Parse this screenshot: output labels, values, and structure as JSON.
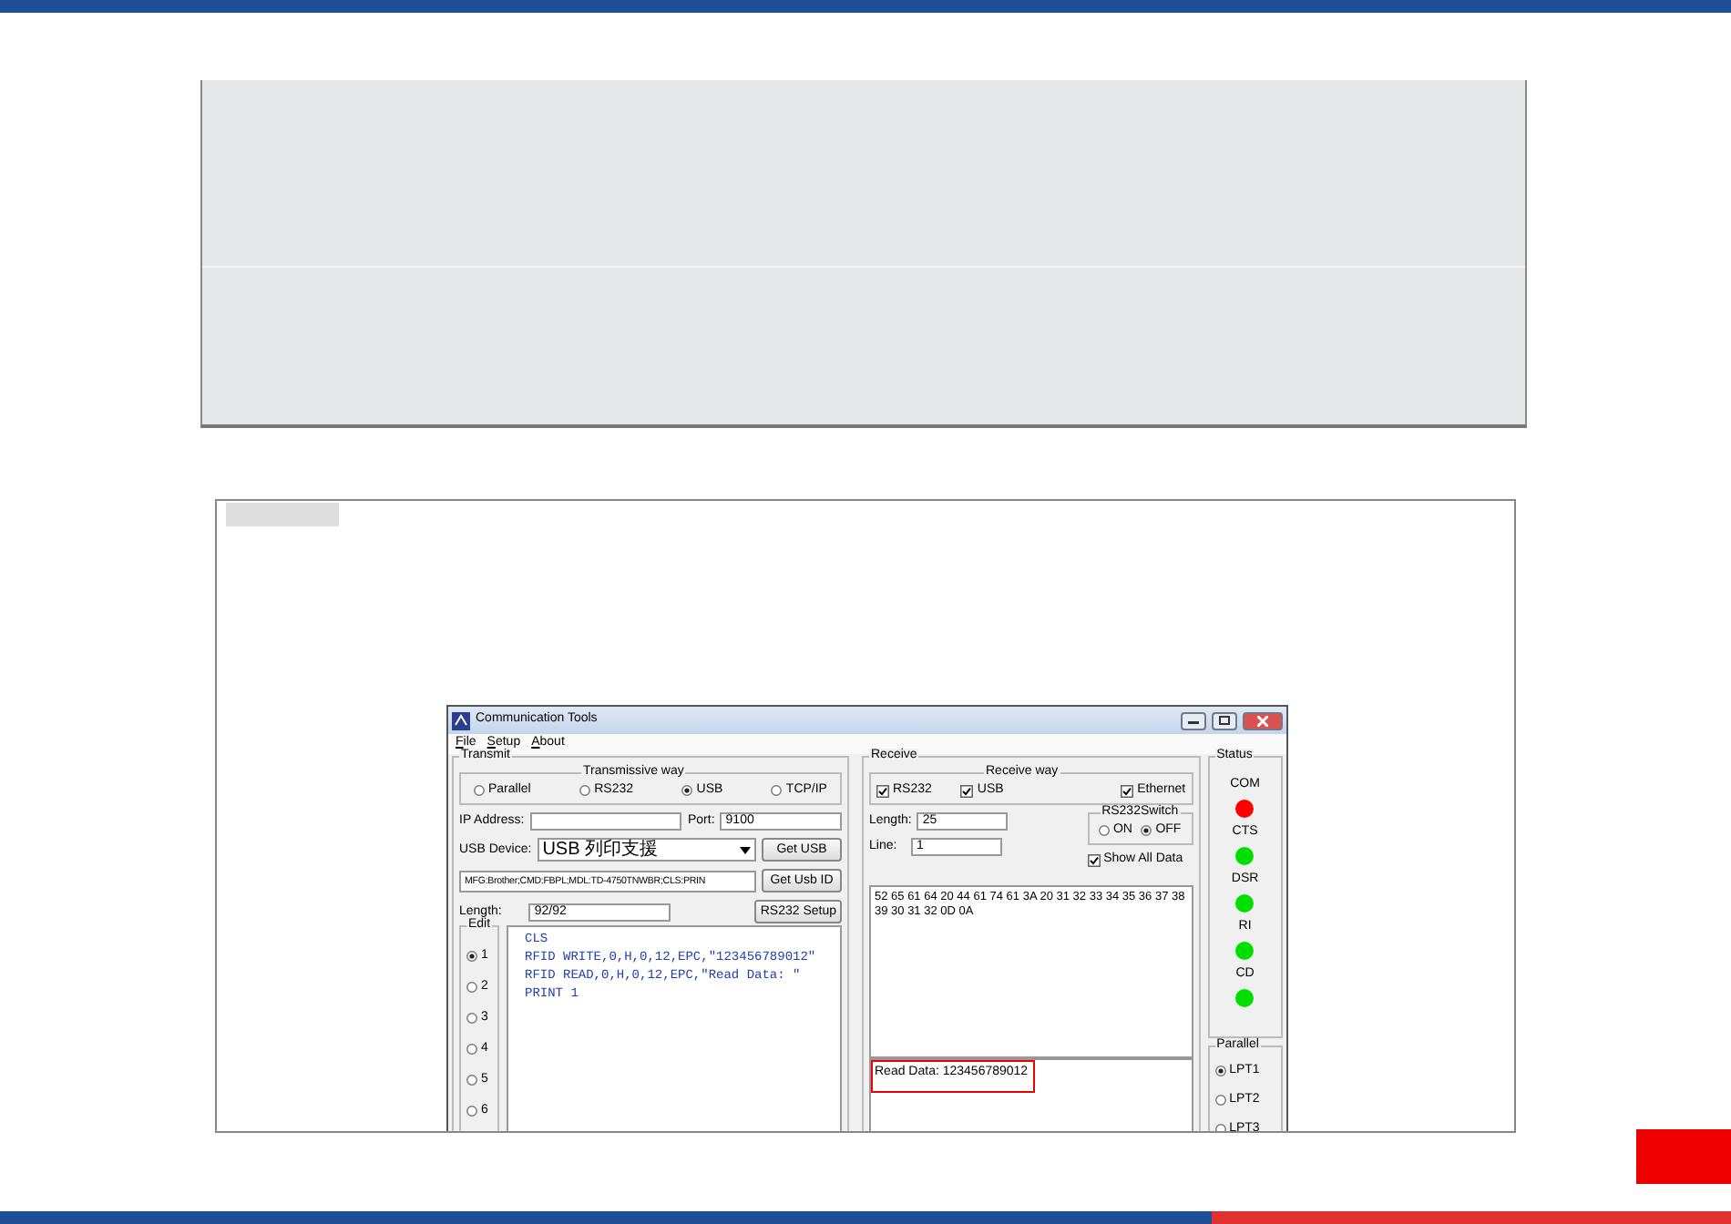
{
  "window": {
    "title": "Communication Tools"
  },
  "menu": [
    "File",
    "Setup",
    "About"
  ],
  "transmit": {
    "legend": "Transmit",
    "way_label": "Transmissive way",
    "ways": [
      {
        "label": "Parallel",
        "selected": false
      },
      {
        "label": "RS232",
        "selected": false
      },
      {
        "label": "USB",
        "selected": true
      },
      {
        "label": "TCP/IP",
        "selected": false
      }
    ],
    "ip_label": "IP Address:",
    "port_label": "Port:",
    "port_value": "9100",
    "usb_label": "USB Device:",
    "usb_value": "USB 列印支援",
    "get_usb": "Get USB",
    "device_id": "MFG:Brother;CMD:FBPL;MDL:TD-4750TNWBR;CLS:PRIN",
    "get_usb_id": "Get Usb ID",
    "length_label": "Length:",
    "length_value": "92/92",
    "rs232_setup": "RS232 Setup",
    "edit_legend": "Edit",
    "edit_slots": [
      {
        "label": "1",
        "selected": true
      },
      {
        "label": "2",
        "selected": false
      },
      {
        "label": "3",
        "selected": false
      },
      {
        "label": "4",
        "selected": false
      },
      {
        "label": "5",
        "selected": false
      },
      {
        "label": "6",
        "selected": false
      }
    ],
    "code_lines": [
      "CLS",
      "RFID WRITE,0,H,0,12,EPC,\"123456789012\"",
      "RFID READ,0,H,0,12,EPC,\"Read Data: \"",
      "PRINT 1"
    ]
  },
  "receive": {
    "legend": "Receive",
    "way_label": "Receive way",
    "ways": [
      {
        "label": "RS232",
        "checked": true
      },
      {
        "label": "USB",
        "checked": true
      },
      {
        "label": "Ethernet",
        "checked": true
      }
    ],
    "switch_label": "RS232Switch",
    "switch": [
      {
        "label": "ON",
        "selected": false
      },
      {
        "label": "OFF",
        "selected": true
      }
    ],
    "length_label": "Length:",
    "length_value": "25",
    "line_label": "Line:",
    "line_value": "1",
    "show_all": {
      "label": "Show All Data",
      "checked": true
    },
    "hex": "52 65 61 64 20 44 61 74 61 3A 20 31 32 33 34 35 36 37 38 39 30 31 32 0D 0A",
    "output": "Read Data: 123456789012"
  },
  "status": {
    "legend": "Status",
    "signals": [
      {
        "label": "COM",
        "color": "#ff0000"
      },
      {
        "label": "CTS",
        "color": "#00e000"
      },
      {
        "label": "DSR",
        "color": "#00e000"
      },
      {
        "label": "RI",
        "color": "#00e000"
      },
      {
        "label": "CD",
        "color": "#00e000"
      }
    ],
    "parallel_legend": "Parallel",
    "ports": [
      {
        "label": "LPT1",
        "selected": true
      },
      {
        "label": "LPT2",
        "selected": false
      },
      {
        "label": "LPT3",
        "selected": false
      }
    ]
  }
}
